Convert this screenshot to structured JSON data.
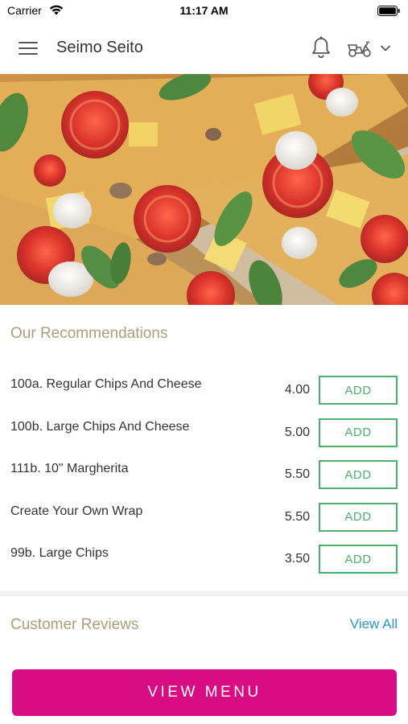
{
  "status_bar": {
    "carrier": "Carrier",
    "time": "11:17 AM"
  },
  "header": {
    "title": "Seimo Seito",
    "icons": [
      "menu-icon",
      "bell-icon",
      "delivery-scooter-icon",
      "chevron-down-icon"
    ]
  },
  "hero": {
    "image": "pizza-photo"
  },
  "recommendations": {
    "title": "Our Recommendations",
    "items": [
      {
        "name": "100a. Regular Chips And Cheese",
        "price": "4.00",
        "button": "ADD"
      },
      {
        "name": "100b. Large Chips And Cheese",
        "price": "5.00",
        "button": "ADD"
      },
      {
        "name": "111b. 10\" Margherita",
        "price": "5.50",
        "button": "ADD"
      },
      {
        "name": "Create Your Own Wrap",
        "price": "5.50",
        "button": "ADD"
      },
      {
        "name": "99b. Large Chips",
        "price": "3.50",
        "button": "ADD"
      }
    ]
  },
  "reviews": {
    "title": "Customer Reviews",
    "view_all": "View All"
  },
  "footer": {
    "view_menu": "VIEW MENU"
  },
  "colors": {
    "accent_pink": "#d80c83",
    "add_green": "#4caf6d",
    "section_title": "#ad9d78",
    "link_blue": "#2a97c4"
  }
}
